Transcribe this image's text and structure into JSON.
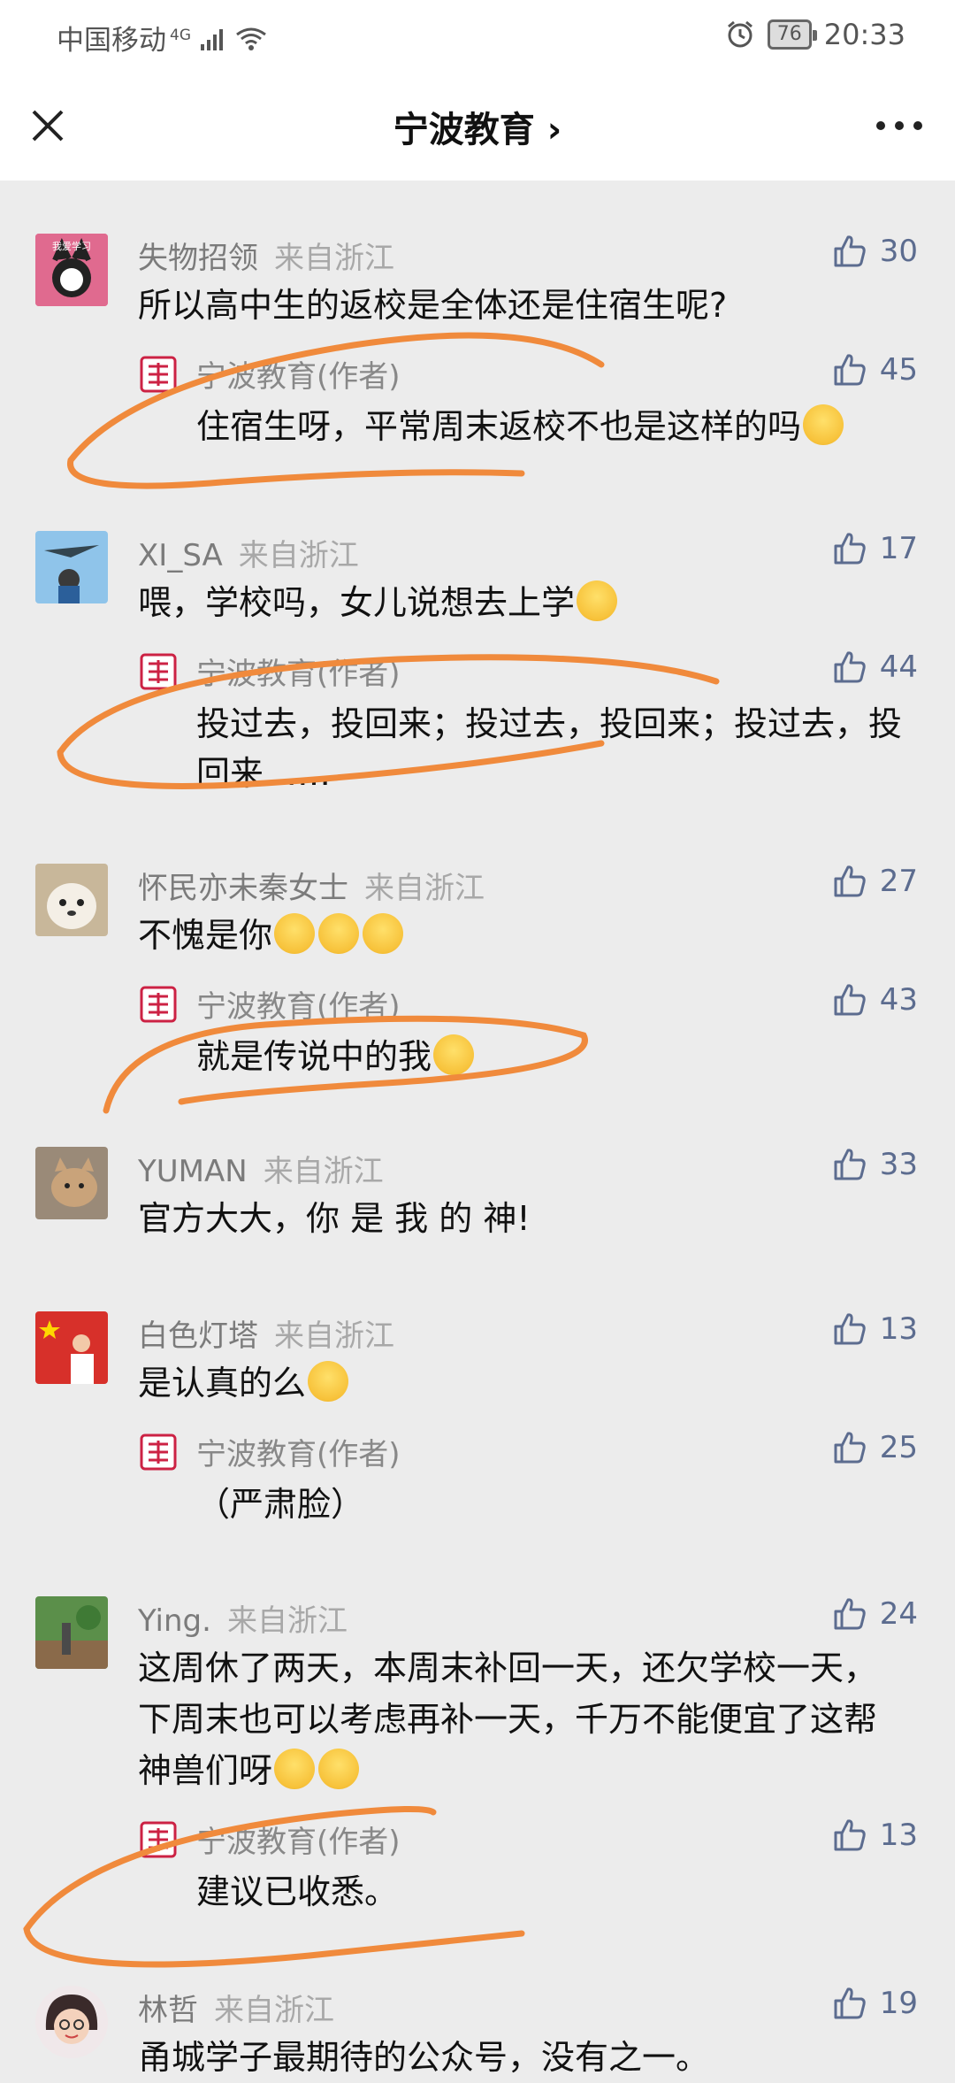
{
  "status": {
    "carrier": "中国移动",
    "network": "4G",
    "battery": "76",
    "time": "20:33"
  },
  "nav": {
    "title": "宁波教育 ›"
  },
  "comments": [
    {
      "name": "失物招领",
      "location": "来自浙江",
      "likes": "30",
      "text": "所以高中生的返校是全体还是住宿生呢?",
      "avatar_label": "我爱学习",
      "reply": {
        "name": "宁波教育(作者)",
        "likes": "45",
        "text": "住宿生呀，平常周末返校不也是这样的吗"
      }
    },
    {
      "name": "XI_SA",
      "location": "来自浙江",
      "likes": "17",
      "text": "喂，学校吗，女儿说想去上学",
      "reply": {
        "name": "宁波教育(作者)",
        "likes": "44",
        "text": "投过去，投回来；投过去，投回来；投过去，投回来……"
      }
    },
    {
      "name": "怀民亦未秦女士",
      "location": "来自浙江",
      "likes": "27",
      "text": "不愧是你",
      "reply": {
        "name": "宁波教育(作者)",
        "likes": "43",
        "text": "就是传说中的我"
      }
    },
    {
      "name": "YUMAN",
      "location": "来自浙江",
      "likes": "33",
      "text": "官方大大，你 是 我 的 神!"
    },
    {
      "name": "白色灯塔",
      "location": "来自浙江",
      "likes": "13",
      "text": "是认真的么",
      "reply": {
        "name": "宁波教育(作者)",
        "likes": "25",
        "text": "（严肃脸）"
      }
    },
    {
      "name": "Ying.",
      "location": "来自浙江",
      "likes": "24",
      "text": "这周休了两天，本周末补回一天，还欠学校一天，下周末也可以考虑再补一天，千万不能便宜了这帮神兽们呀",
      "reply": {
        "name": "宁波教育(作者)",
        "likes": "13",
        "text": "建议已收悉。"
      }
    },
    {
      "name": "林哲",
      "location": "来自浙江",
      "likes": "19",
      "text": "甬城学子最期待的公众号，没有之一。"
    }
  ],
  "colors": {
    "like": "#5c6c8f",
    "scribble": "#f08a3c",
    "background": "#ececec"
  },
  "icons": {
    "close": "close-icon",
    "more": "more-icon",
    "like": "thumbs-up-icon"
  }
}
